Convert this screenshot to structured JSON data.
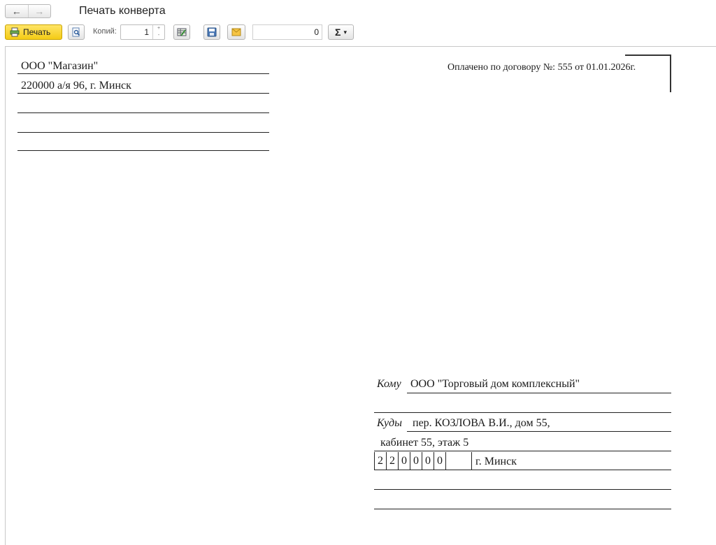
{
  "window": {
    "title": "Печать конверта",
    "back_icon": "←",
    "forward_icon": "→"
  },
  "toolbar": {
    "print_label": "Печать",
    "copies_label": "Копий:",
    "copies_value": "1",
    "amount_value": "0",
    "sum_icon": "Σ",
    "sum_dropdown": "▾"
  },
  "sender": {
    "line1": "ООО \"Магазин\"",
    "line2": "220000 а/я 96, г. Минск",
    "line3": "",
    "line4": ""
  },
  "paid_note": "Оплачено по договору №: 555 от 01.01.2026г.",
  "recipient": {
    "to_label": "Кому",
    "to_value": "ООО \"Торговый дом комплексный\"",
    "where_label": "Куды",
    "address_line1": "пер. КОЗЛОВА В.И., дом 55,",
    "address_line2": "кабинет 55, этаж 5",
    "postal_digits": [
      "2",
      "2",
      "0",
      "0",
      "0",
      "0"
    ],
    "city": "г. Минск"
  }
}
